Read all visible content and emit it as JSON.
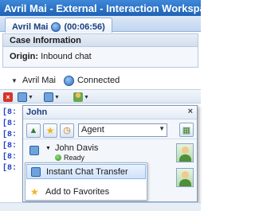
{
  "window": {
    "title": "Avril Mai - External - Interaction Workspace"
  },
  "tab": {
    "label": "Avril Mai",
    "timer": "(00:06:56)",
    "icon": "chat-icon"
  },
  "case": {
    "header": "Case Information",
    "origin_label": "Origin:",
    "origin_value": "Inbound chat"
  },
  "party": {
    "name": "Avril Mai",
    "status": "Connected"
  },
  "transcript": {
    "lines": [
      "[8:",
      "[8:",
      "[8:",
      "[8:",
      "[8:",
      "[8:"
    ]
  },
  "popup": {
    "title": "John",
    "close_icon": "close-icon",
    "filter_value": "Agent",
    "contacts": [
      {
        "name": "John Davis",
        "status": "Ready"
      }
    ],
    "menu": [
      {
        "label": "Instant Chat Transfer",
        "icon": "chat-transfer-icon"
      },
      {
        "label": "Add to Favorites",
        "icon": "star-icon"
      }
    ]
  },
  "colors": {
    "title_bar": "#2a71c6",
    "link_text": "#1e40c8",
    "ready": "#2f8f1f",
    "favorite": "#f0b419"
  }
}
